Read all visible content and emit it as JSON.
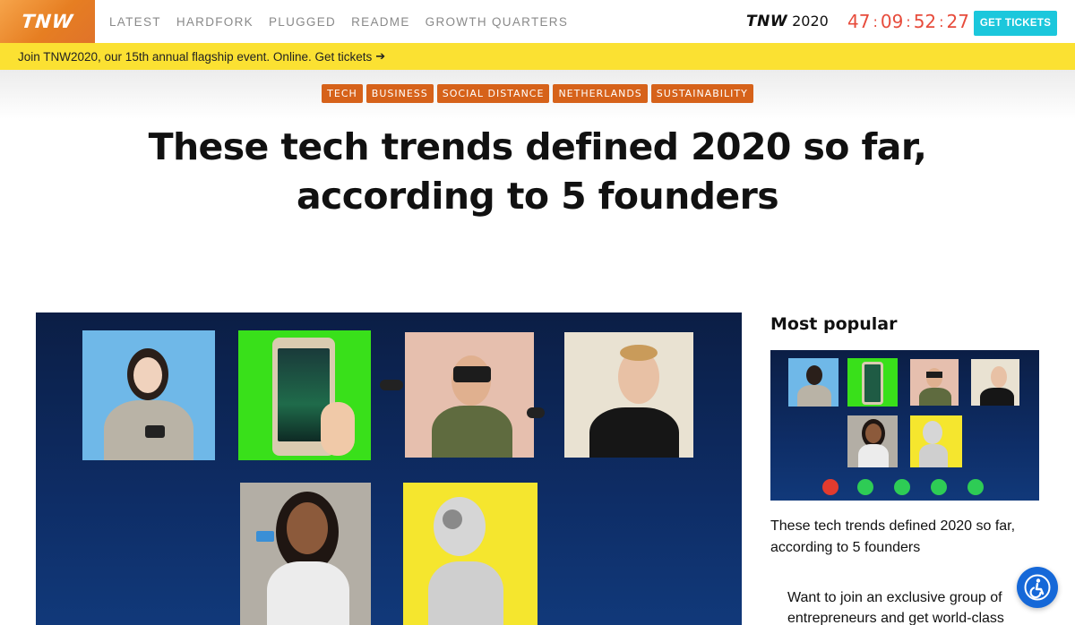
{
  "header": {
    "logo_text": "TNW",
    "nav": [
      "LATEST",
      "HARDFORK",
      "PLUGGED",
      "README",
      "GROWTH QUARTERS"
    ],
    "event_logo": "TNW",
    "event_year": "2020",
    "countdown": {
      "days": "47",
      "hours": "09",
      "minutes": "52",
      "seconds": "27",
      "separator": ":"
    },
    "cta_label": "GET TICKETS"
  },
  "promo": {
    "text": "Join TNW2020, our 15th annual flagship event. Online. Get tickets",
    "arrow": "➔"
  },
  "article": {
    "tags": [
      "TECH",
      "BUSINESS",
      "SOCIAL DISTANCE",
      "NETHERLANDS",
      "SUSTAINABILITY"
    ],
    "title": "These tech trends defined 2020 so far, according to 5 founders"
  },
  "sidebar": {
    "heading": "Most popular",
    "popular_title": "These tech trends defined 2020 so far, according to 5 founders",
    "newsletter_text": "Want to join an exclusive group of entrepreneurs and get world-class"
  },
  "colors": {
    "accent_orange": "#e67e22",
    "tag_orange": "#d6621a",
    "promo_yellow": "#fbe132",
    "cta_cyan": "#1bc7dc",
    "countdown_red": "#e74c3c",
    "a11y_blue": "#1568d8"
  },
  "icons": {
    "accessibility": "accessibility-icon",
    "promo_arrow": "arrow-right-icon"
  }
}
